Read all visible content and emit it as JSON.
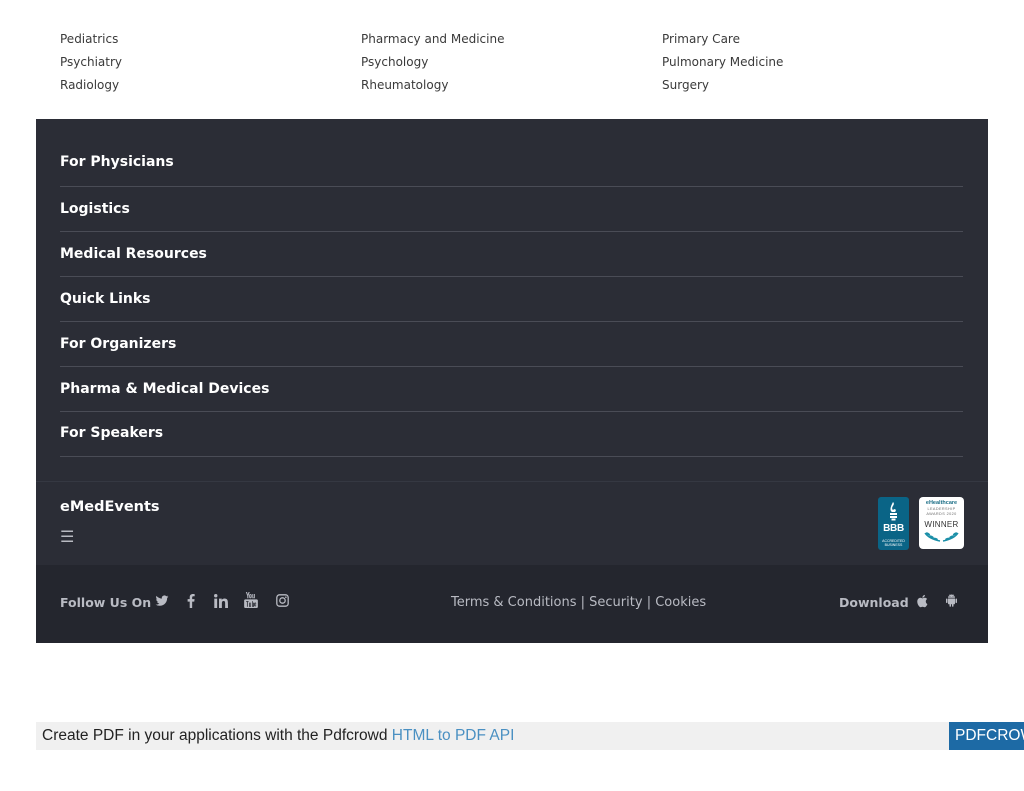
{
  "specialties": {
    "columns": [
      [
        "Pediatrics",
        "Psychiatry",
        "Radiology"
      ],
      [
        "Pharmacy and Medicine",
        "Psychology",
        "Rheumatology"
      ],
      [
        "Primary Care",
        "Pulmonary Medicine",
        "Surgery"
      ]
    ]
  },
  "footer": {
    "sections": [
      "For Physicians",
      "Logistics",
      "Medical Resources",
      "Quick Links",
      "For Organizers",
      "Pharma & Medical Devices",
      "For Speakers"
    ],
    "brand": "eMedEvents",
    "menu_icon": "☰",
    "bbb_badge": {
      "letters": "BBB",
      "small": "ACCREDITED BUSINESS"
    },
    "award_badge": {
      "title": "eHealthcare",
      "subtitle": "LEADERSHIP AWARDS 2020",
      "label": "WINNER"
    }
  },
  "bottom_bar": {
    "follow_label": "Follow Us On",
    "social_icons": [
      "twitter-icon",
      "facebook-icon",
      "linkedin-icon",
      "youtube-icon",
      "instagram-icon"
    ],
    "legal": {
      "terms": "Terms & Conditions",
      "security": "Security",
      "cookies": "Cookies",
      "separator": "|"
    },
    "download_label": "Download",
    "app_icons": [
      "apple-icon",
      "android-icon"
    ]
  },
  "pdf_banner": {
    "text": "Create PDF in your applications with the Pdfcrowd",
    "link": "HTML to PDF API",
    "button": "PDFCROWD"
  },
  "colors": {
    "footer_bg": "#2b2d36",
    "bottom_bg": "#24262e",
    "banner_button": "#1d6aa5",
    "banner_link": "#4a90c2"
  }
}
